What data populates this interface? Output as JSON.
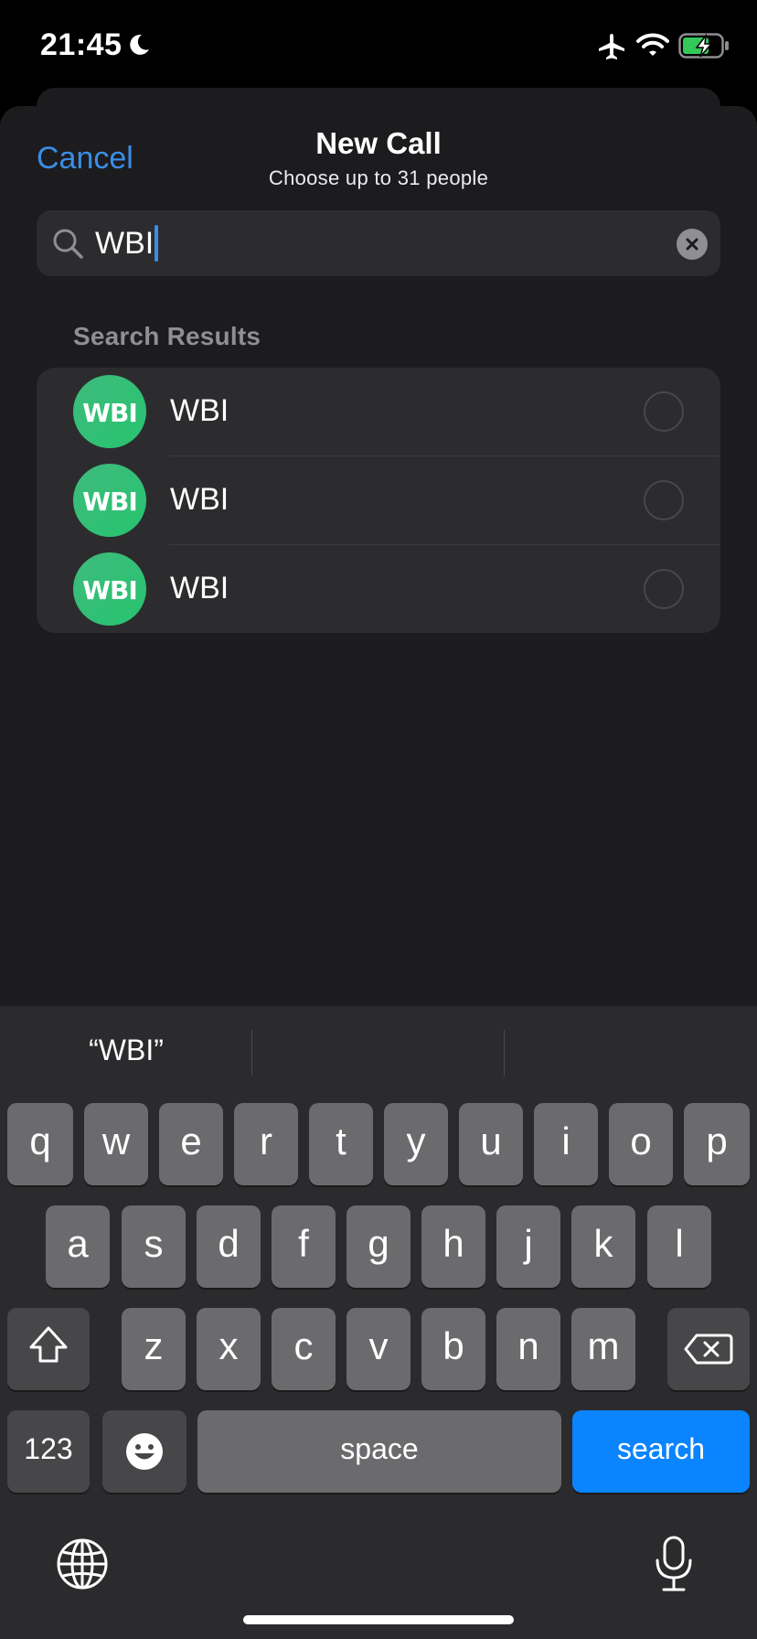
{
  "status_bar": {
    "time": "21:45"
  },
  "header": {
    "cancel_label": "Cancel",
    "title": "New Call",
    "subtitle": "Choose up to 31 people"
  },
  "search": {
    "value": "WBI"
  },
  "results": {
    "section_title": "Search Results",
    "items": [
      {
        "avatar_text": "WBI",
        "name": "WBI",
        "selected": false
      },
      {
        "avatar_text": "WBI",
        "name": "WBI",
        "selected": false
      },
      {
        "avatar_text": "WBI",
        "name": "WBI",
        "selected": false
      }
    ]
  },
  "keyboard": {
    "suggestions": [
      "“WBI”",
      "",
      ""
    ],
    "row1": [
      "q",
      "w",
      "e",
      "r",
      "t",
      "y",
      "u",
      "i",
      "o",
      "p"
    ],
    "row2": [
      "a",
      "s",
      "d",
      "f",
      "g",
      "h",
      "j",
      "k",
      "l"
    ],
    "row3": [
      "z",
      "x",
      "c",
      "v",
      "b",
      "n",
      "m"
    ],
    "numbers_label": "123",
    "space_label": "space",
    "search_label": "search"
  },
  "colors": {
    "accent": "#3a8ee6",
    "search_key": "#0a84ff",
    "avatar": "#26c46f"
  }
}
